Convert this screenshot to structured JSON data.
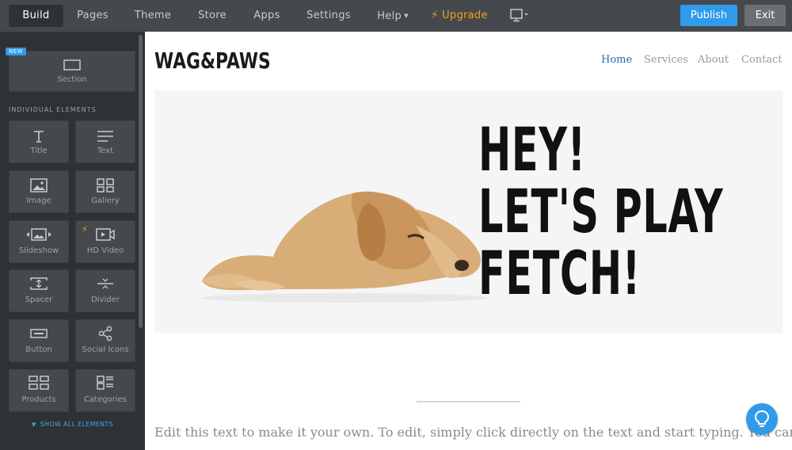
{
  "topbar": {
    "tabs": [
      "Build",
      "Pages",
      "Theme",
      "Store",
      "Apps",
      "Settings",
      "Help"
    ],
    "upgrade_label": "Upgrade",
    "publish_label": "Publish",
    "exit_label": "Exit",
    "colors": {
      "bar": "#45494d",
      "publish": "#2f9bea",
      "upgrade": "#f6a01a"
    }
  },
  "sidebar": {
    "new_badge": "NEW",
    "section_tile": "Section",
    "heading": "INDIVIDUAL ELEMENTS",
    "elements": [
      "Title",
      "Text",
      "Image",
      "Gallery",
      "Slideshow",
      "HD Video",
      "Spacer",
      "Divider",
      "Button",
      "Social Icons",
      "Products",
      "Categories"
    ],
    "show_all": "SHOW ALL ELEMENTS"
  },
  "site": {
    "logo": "WAG&PAWS",
    "nav": [
      "Home",
      "Services",
      "About",
      "Contact"
    ],
    "hero_lines": [
      "HEY!",
      "LET'S PLAY",
      "FETCH!"
    ],
    "body_text": "Edit this text to make it your own. To edit, simply click directly on the text and start typing. You can move"
  }
}
